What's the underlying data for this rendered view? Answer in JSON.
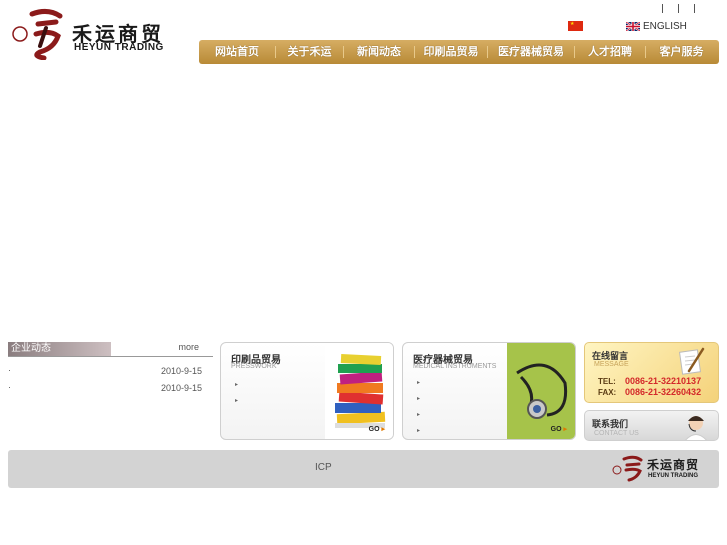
{
  "brand": {
    "name_cn": "禾运商贸",
    "name_en": "HEYUN TRADING",
    "logo_seal_text": "禾运"
  },
  "language": {
    "chinese_flag": "china-flag-icon",
    "english_label": "ENGLISH"
  },
  "nav": {
    "items": [
      {
        "label": "网站首页"
      },
      {
        "label": "关于禾运"
      },
      {
        "label": "新闻动态"
      },
      {
        "label": "印刷品贸易"
      },
      {
        "label": "医疗器械贸易"
      },
      {
        "label": "人才招聘"
      },
      {
        "label": "客户服务"
      }
    ]
  },
  "news": {
    "title": "企业动态",
    "more": "more",
    "items": [
      {
        "bullet": "·",
        "date": "2010-9-15"
      },
      {
        "bullet": "·",
        "date": "2010-9-15"
      }
    ]
  },
  "products": [
    {
      "title": "印刷品贸易",
      "subtitle": "PRESSWORK",
      "bullets": [
        "▸",
        "▸"
      ],
      "go": "GO",
      "image": "books-stack-image"
    },
    {
      "title": "医疗器械贸易",
      "subtitle": "MEDICAL INSTRUMENTS",
      "bullets": [
        "▸",
        "▸",
        "▸",
        "▸"
      ],
      "go": "GO",
      "image": "stethoscope-image"
    }
  ],
  "message": {
    "title": "在线留言",
    "subtitle": "MESSAGE",
    "tel_label": "TEL:",
    "tel": "0086-21-32210137",
    "fax_label": "FAX:",
    "fax": "0086-21-32260432"
  },
  "contact": {
    "title": "联系我们",
    "subtitle": "CONTACT US"
  },
  "footer": {
    "icp": "ICP"
  },
  "colors": {
    "nav_gold": "#c89a48",
    "phone_red": "#d3282a",
    "logo_red": "#8b1a1a"
  }
}
